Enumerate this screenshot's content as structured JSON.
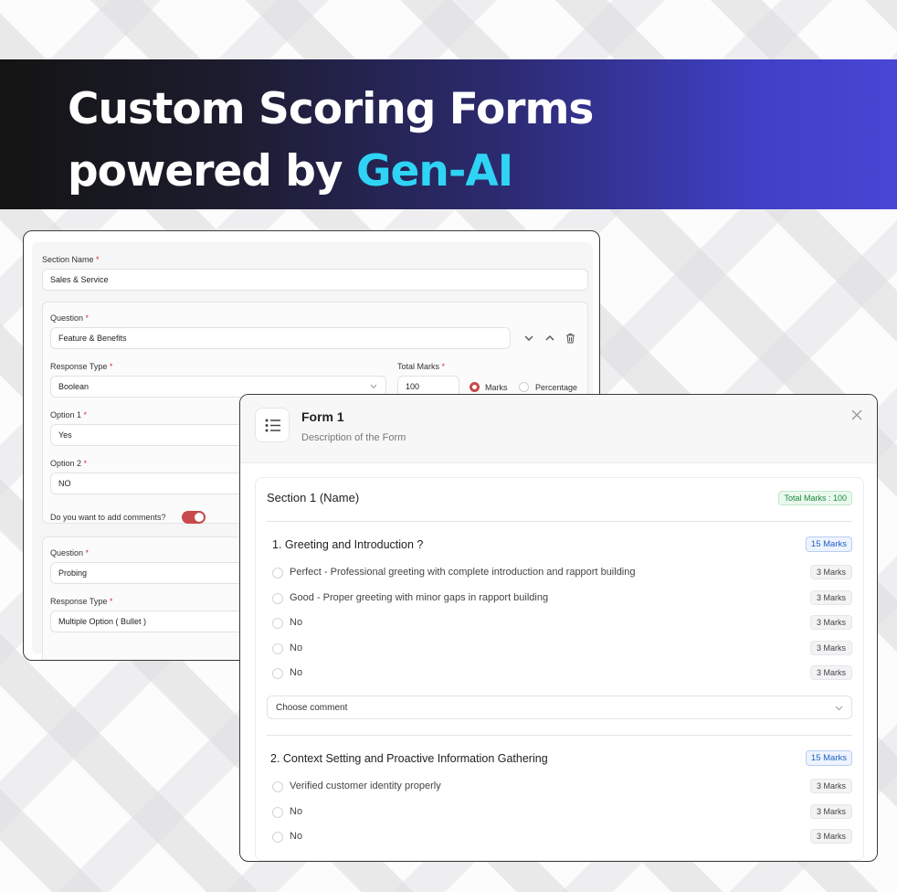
{
  "headline": {
    "line1": "Custom Scoring Forms",
    "line2_prefix": "powered by ",
    "line2_accent": "Gen-AI"
  },
  "colors": {
    "accent_cyan": "#2fd4f5",
    "brand_red": "#c84a4a",
    "marks_green": "#1c8a3e",
    "marks_blue": "#1f5fbf"
  },
  "editor": {
    "section_name_label": "Section Name",
    "section_name_value": "Sales & Service",
    "required_mark": "*",
    "q1": {
      "question_label": "Question",
      "question_value": "Feature & Benefits",
      "response_type_label": "Response Type",
      "response_type_value": "Boolean",
      "total_marks_label": "Total Marks",
      "total_marks_value": "100",
      "marks_radio": "Marks",
      "percentage_radio": "Percentage",
      "option1_label": "Option 1",
      "option1_value": "Yes",
      "option2_label": "Option 2",
      "option2_value": "NO",
      "comments_label": "Do you want to add comments?"
    },
    "q2": {
      "question_label": "Question",
      "question_value": "Probing",
      "response_type_label": "Response Type",
      "response_type_value": "Multiple Option ( Bullet )"
    }
  },
  "form": {
    "title": "Form 1",
    "description": "Description of the Form",
    "section_title": "Section 1 (Name)",
    "total_marks_badge": "Total Marks : 100",
    "questions": [
      {
        "title": "1. Greeting and Introduction ?",
        "marks": "15 Marks",
        "options": [
          {
            "text": "Perfect - Professional greeting with complete introduction and rapport building",
            "marks": "3 Marks"
          },
          {
            "text": "Good - Proper greeting with minor gaps in rapport building",
            "marks": "3 Marks"
          },
          {
            "text": "No",
            "marks": "3 Marks"
          },
          {
            "text": "No",
            "marks": "3 Marks"
          },
          {
            "text": "No",
            "marks": "3 Marks"
          }
        ],
        "comment_placeholder": "Choose comment"
      },
      {
        "title": "2. Context Setting and Proactive Information Gathering",
        "marks": "15 Marks",
        "options": [
          {
            "text": "Verified customer identity properly",
            "marks": "3 Marks"
          },
          {
            "text": "No",
            "marks": "3 Marks"
          },
          {
            "text": "No",
            "marks": "3 Marks"
          }
        ]
      }
    ]
  },
  "icons": {
    "chevron_down": "chevron-down-icon",
    "chevron_up": "chevron-up-icon",
    "trash": "trash-icon",
    "close": "close-icon",
    "list": "list-icon"
  }
}
